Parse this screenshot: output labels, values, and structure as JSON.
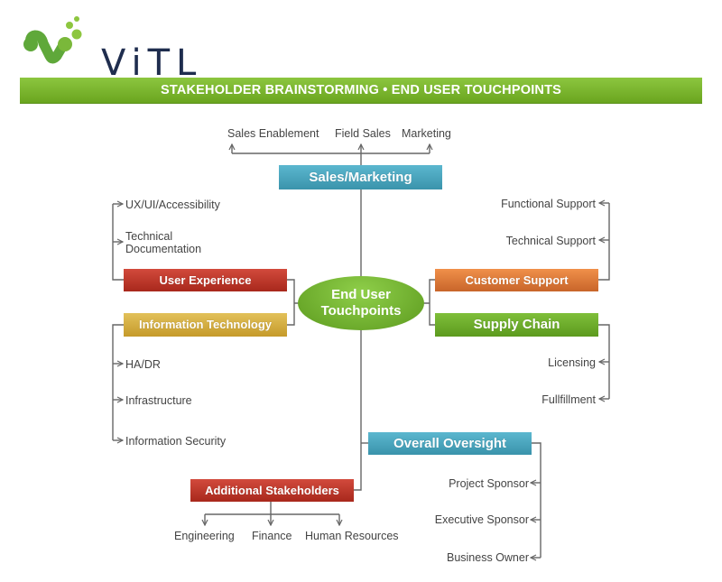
{
  "logo": {
    "text": "ViTL",
    "icon": "vitl-molecule-logo-icon"
  },
  "banner": {
    "title": "STAKEHOLDER BRAINSTORMING • END USER TOUCHPOINTS"
  },
  "colors": {
    "banner_green": "#7ab632",
    "teal": "#4aa6be",
    "red": "#bc3a2c",
    "gold": "#d4ad42",
    "orange": "#dd7a3a",
    "green": "#6eac2c",
    "connector": "#666666",
    "logo_navy": "#1f2d4e"
  },
  "center": {
    "line1": "End User",
    "line2": "Touchpoints"
  },
  "branches": {
    "sales_marketing": {
      "label": "Sales/Marketing",
      "children": [
        "Sales Enablement",
        "Field Sales",
        "Marketing"
      ]
    },
    "user_experience": {
      "label": "User Experience",
      "children": [
        "UX/UI/Accessibility",
        "Technical",
        "Documentation"
      ]
    },
    "information_technology": {
      "label": "Information Technology",
      "children": [
        "HA/DR",
        "Infrastructure",
        "Information Security"
      ]
    },
    "customer_support": {
      "label": "Customer Support",
      "children": [
        "Functional Support",
        "Technical Support"
      ]
    },
    "supply_chain": {
      "label": "Supply Chain",
      "children": [
        "Licensing",
        "Fullfillment"
      ]
    },
    "overall_oversight": {
      "label": "Overall Oversight",
      "children": [
        "Project Sponsor",
        "Executive Sponsor",
        "Business Owner"
      ]
    },
    "additional_stakeholders": {
      "label": "Additional Stakeholders",
      "children": [
        "Engineering",
        "Finance",
        "Human Resources"
      ]
    }
  }
}
